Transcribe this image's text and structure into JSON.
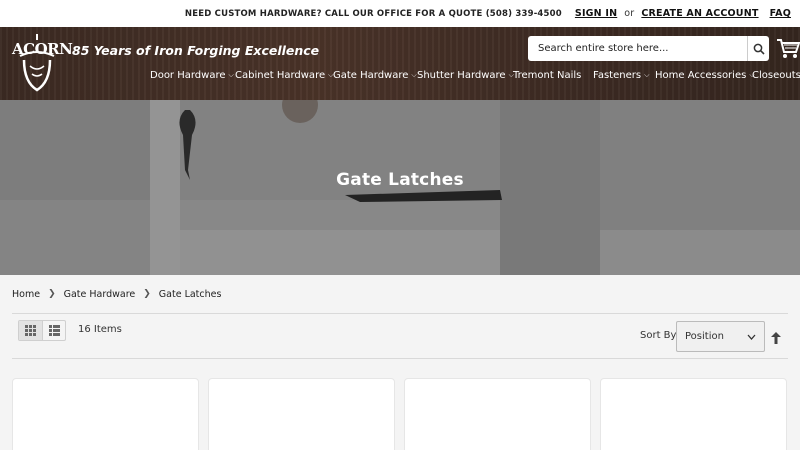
{
  "topbar": {
    "notice": "NEED CUSTOM HARDWARE? CALL OUR OFFICE FOR A QUOTE (508) 339-4500",
    "sign_in": "SIGN IN",
    "or": "or",
    "create_account": "CREATE AN ACCOUNT",
    "faq": "FAQ"
  },
  "header": {
    "logo_text": "ACORN",
    "tagline": "85 Years of Iron Forging Excellence",
    "search_placeholder": "Search entire store here..."
  },
  "nav": [
    {
      "label": "Door Hardware",
      "dropdown": true
    },
    {
      "label": "Cabinet Hardware",
      "dropdown": true
    },
    {
      "label": "Gate Hardware",
      "dropdown": true
    },
    {
      "label": "Shutter Hardware",
      "dropdown": true
    },
    {
      "label": "Tremont Nails",
      "dropdown": false
    },
    {
      "label": "Fasteners",
      "dropdown": true
    },
    {
      "label": "Home Accessories",
      "dropdown": true
    },
    {
      "label": "Closeouts",
      "dropdown": false
    }
  ],
  "hero": {
    "title": "Gate Latches"
  },
  "breadcrumbs": [
    "Home",
    "Gate Hardware",
    "Gate Latches"
  ],
  "toolbar": {
    "count": "16 Items",
    "sort_label": "Sort By",
    "sort_value": "Position"
  },
  "colors": {
    "header_bg": "#3b2a22",
    "page_bg": "#f4f4f4"
  }
}
